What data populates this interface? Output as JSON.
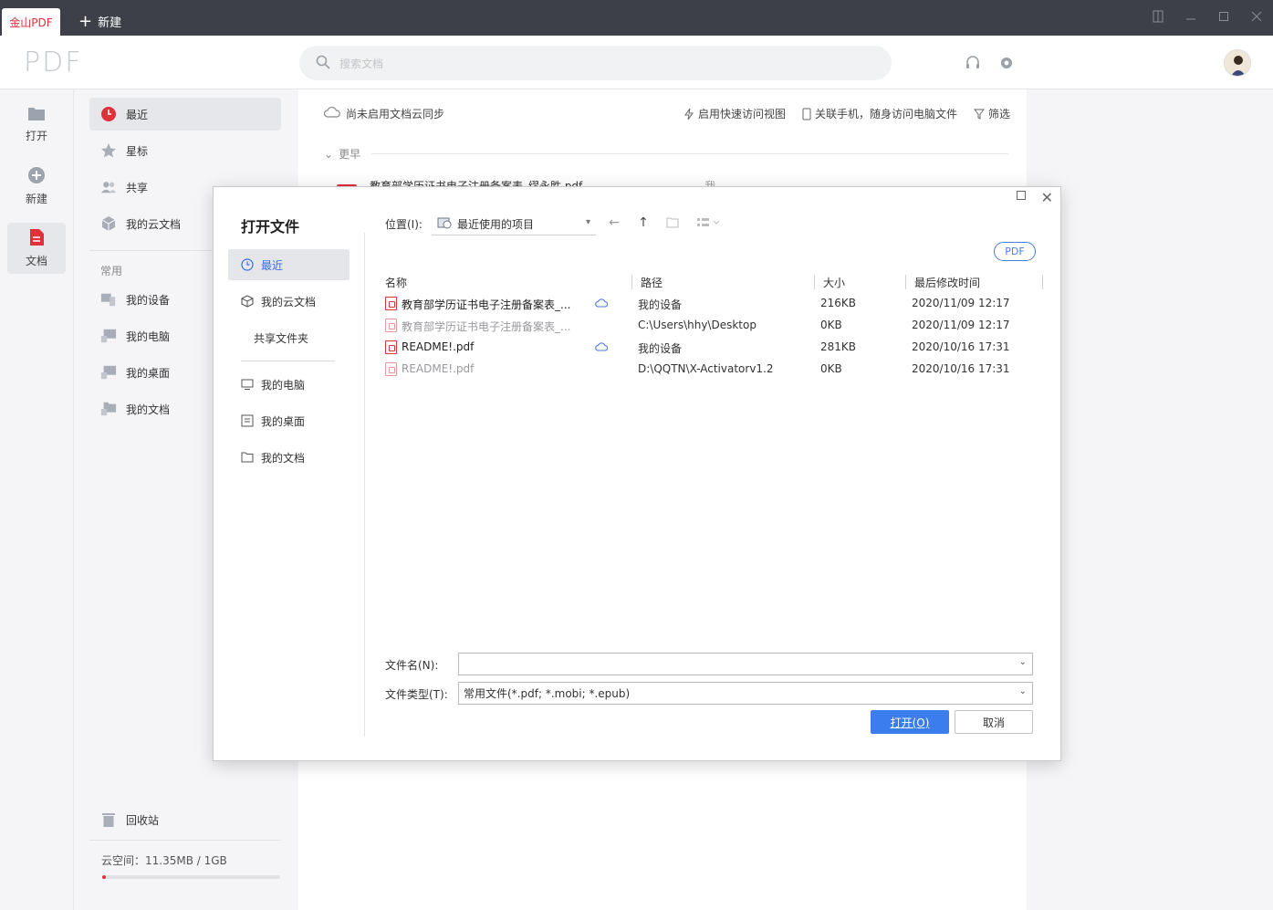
{
  "titlebar": {
    "app_tab": "金山PDF",
    "new_tab": "新建"
  },
  "header": {
    "logo": "PDF",
    "search_placeholder": "搜索文档"
  },
  "leftnav": {
    "items": [
      {
        "label": "打开",
        "icon": "folder-icon"
      },
      {
        "label": "新建",
        "icon": "plus-circle-icon"
      },
      {
        "label": "文档",
        "icon": "document-icon"
      }
    ]
  },
  "sidebar": {
    "items": [
      {
        "label": "最近",
        "icon": "clock-icon"
      },
      {
        "label": "星标",
        "icon": "star-icon"
      },
      {
        "label": "共享",
        "icon": "people-icon"
      },
      {
        "label": "我的云文档",
        "icon": "cube-icon"
      }
    ],
    "section_title": "常用",
    "common": [
      {
        "label": "我的设备",
        "icon": "device-icon"
      },
      {
        "label": "我的电脑",
        "icon": "computer-icon"
      },
      {
        "label": "我的桌面",
        "icon": "desktop-icon"
      },
      {
        "label": "我的文档",
        "icon": "folder-icon"
      }
    ],
    "trash": "回收站",
    "storage": "云空间：11.35MB / 1GB",
    "storage_fraction": 0.011
  },
  "main": {
    "cloud_sync": "尚未启用文档云同步",
    "actions": [
      "启用快速访问视图",
      "关联手机，随身访问电脑文件",
      "筛选"
    ],
    "group_label": "更早",
    "bg_file_name": "教育部学历证书电子注册备案表_缪永胜.pdf",
    "bg_file_extra": "我"
  },
  "dialog": {
    "title": "打开文件",
    "side": [
      {
        "label": "最近",
        "icon": "clock-icon"
      },
      {
        "label": "我的云文档",
        "icon": "cube-icon"
      },
      {
        "label": "共享文件夹",
        "icon": ""
      },
      {
        "label": "我的电脑",
        "icon": "monitor-icon"
      },
      {
        "label": "我的桌面",
        "icon": "desktop-icon"
      },
      {
        "label": "我的文档",
        "icon": "folder-icon"
      }
    ],
    "location_label": "位置(I):",
    "location_value": "最近使用的项目",
    "filter_pill": "PDF",
    "columns": [
      "名称",
      "路径",
      "大小",
      "最后修改时间"
    ],
    "files": [
      {
        "name": "教育部学历证书电子注册备案表_...",
        "path": "我的设备",
        "size": "216KB",
        "modified": "2020/11/09 12:17",
        "cloud": true,
        "dim": false
      },
      {
        "name": "教育部学历证书电子注册备案表_...",
        "path": "C:\\Users\\hhy\\Desktop",
        "size": "0KB",
        "modified": "2020/11/09 12:17",
        "cloud": false,
        "dim": true
      },
      {
        "name": "README!.pdf",
        "path": "我的设备",
        "size": "281KB",
        "modified": "2020/10/16 17:31",
        "cloud": true,
        "dim": false
      },
      {
        "name": "README!.pdf",
        "path": "D:\\QQTN\\X-Activatorv1.2",
        "size": "0KB",
        "modified": "2020/10/16 17:31",
        "cloud": false,
        "dim": true
      }
    ],
    "filename_label": "文件名(N):",
    "filename_value": "",
    "filetype_label": "文件类型(T):",
    "filetype_value": "常用文件(*.pdf; *.mobi; *.epub)",
    "open_button": "打开(O)",
    "cancel_button": "取消"
  },
  "colors": {
    "accent_red": "#e0303a",
    "accent_blue": "#3b7ded"
  }
}
